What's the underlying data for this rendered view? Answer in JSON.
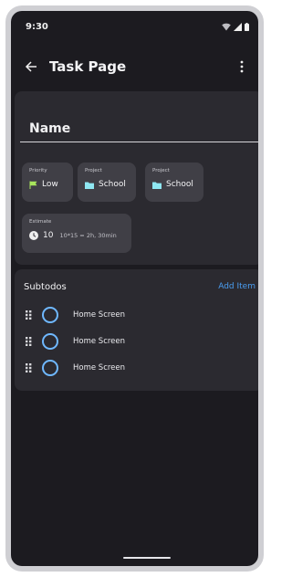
{
  "status_bar": {
    "time": "9:30"
  },
  "app_bar": {
    "title": "Task Page"
  },
  "task": {
    "name": "Name",
    "chips": [
      {
        "label": "Priority",
        "value": "Low",
        "icon": "flag-icon",
        "icon_color": "#a8e65c"
      },
      {
        "label": "Project",
        "value": "School",
        "icon": "folder-icon",
        "icon_color": "#8fe7f2"
      },
      {
        "label": "Project",
        "value": "School",
        "icon": "folder-icon",
        "icon_color": "#8fe7f2"
      }
    ],
    "estimate": {
      "label": "Estimate",
      "value": "10",
      "detail": "10*15 = 2h, 30min",
      "icon": "clock-icon"
    }
  },
  "subtodos": {
    "title": "Subtodos",
    "add_label": "Add Item",
    "items": [
      {
        "text": "Home Screen"
      },
      {
        "text": "Home Screen"
      },
      {
        "text": "Home Screen"
      }
    ]
  },
  "colors": {
    "background": "#1c1b20",
    "card": "#2b2a30",
    "chip": "#403f46",
    "accent": "#4a9df0",
    "checkbox": "#6fb8ff"
  }
}
